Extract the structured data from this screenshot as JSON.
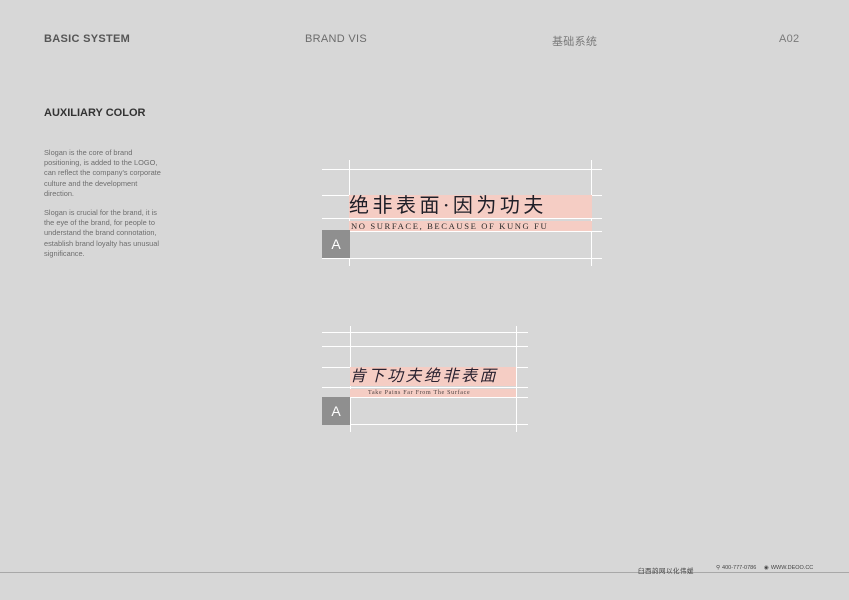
{
  "header": {
    "left": "BASIC SYSTEM",
    "center": "BRAND VIS",
    "right_cn": "基础系统",
    "page_code": "A02"
  },
  "section": {
    "title": "AUXILIARY COLOR",
    "paragraphs": [
      "Slogan is the core of brand positioning, is added to the LOGO, can reflect the company's corporate culture and the development direction.",
      "Slogan is crucial for the brand, it is the eye of the brand, for people to understand the brand connotation, establish brand loyalty has unusual significance."
    ]
  },
  "slogans": [
    {
      "marker": "A",
      "cn": "绝非表面·因为功夫",
      "en": "NO SURFACE, BECAUSE OF KUNG FU"
    },
    {
      "marker": "A",
      "cn": "肯下功夫绝非表面",
      "en": "Take Pains Far From The Surface"
    }
  ],
  "footer": {
    "company": "臼西韵网以化伟媛",
    "phone": "400-777-0786",
    "website": "WWW.DEOO.CC"
  },
  "colors": {
    "background": "#d7d7d7",
    "highlight_pink": "#f5cdc4",
    "marker_gray": "#8f8f8f",
    "guide_line": "#ffffff"
  }
}
